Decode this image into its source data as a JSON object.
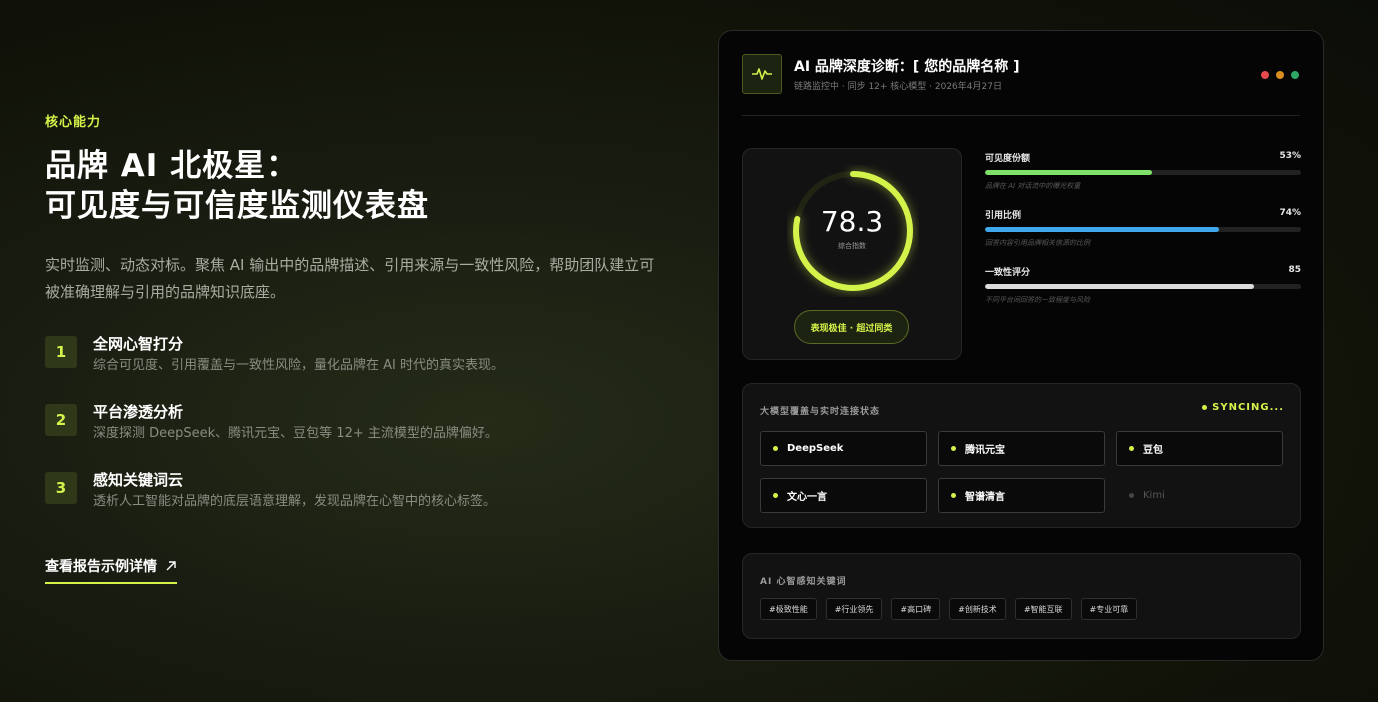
{
  "left": {
    "eyebrow": "核心能力",
    "headline_line1": "品牌 AI 北极星：",
    "headline_line2": "可见度与可信度监测仪表盘",
    "description": "实时监测、动态对标。聚焦 AI 输出中的品牌描述、引用来源与一致性风险，帮助团队建立可被准确理解与引用的品牌知识底座。",
    "features": [
      {
        "num": "1",
        "title": "全网心智打分",
        "desc": "综合可见度、引用覆盖与一致性风险，量化品牌在 AI 时代的真实表现。"
      },
      {
        "num": "2",
        "title": "平台渗透分析",
        "desc": "深度探测 DeepSeek、腾讯元宝、豆包等 12+ 主流模型的品牌偏好。"
      },
      {
        "num": "3",
        "title": "感知关键词云",
        "desc": "透析人工智能对品牌的底层语意理解，发现品牌在心智中的核心标签。"
      }
    ],
    "cta_label": "查看报告示例详情"
  },
  "card": {
    "title": "AI 品牌深度诊断：[ 您的品牌名称 ]",
    "subtitle": "链路监控中 · 同步 12+ 核心模型 · 2026年4月27日",
    "window_dots": [
      "#e5484d",
      "#d98d1f",
      "#2ea866"
    ],
    "gauge": {
      "score": "78.3",
      "score_fraction": 0.783,
      "label": "综合指数",
      "badge": "表现极佳 · 超过同类"
    },
    "metrics": [
      {
        "name": "可见度份额",
        "value": "53%",
        "fill": 0.53,
        "note": "品牌在 AI 对话流中的曝光权重",
        "color": "#7fe06a"
      },
      {
        "name": "引用比例",
        "value": "74%",
        "fill": 0.74,
        "note": "回答内容引用品牌相关信源的比例",
        "color": "#3fa8ec"
      },
      {
        "name": "一致性评分",
        "value": "85",
        "fill": 0.85,
        "note": "不同平台间回答的一致程度与风险",
        "color": "#dcdcdc"
      }
    ],
    "models_label": "大模型覆盖与实时连接状态",
    "sync_label": "SYNCING...",
    "models": [
      {
        "name": "DeepSeek",
        "active": true
      },
      {
        "name": "腾讯元宝",
        "active": true
      },
      {
        "name": "豆包",
        "active": true
      },
      {
        "name": "文心一言",
        "active": true
      },
      {
        "name": "智谱清言",
        "active": true
      },
      {
        "name": "Kimi",
        "active": false
      }
    ],
    "keywords_label": "AI 心智感知关键词",
    "keywords": [
      "#极致性能",
      "#行业领先",
      "#高口碑",
      "#创新技术",
      "#智能互联",
      "#专业可靠"
    ]
  },
  "colors": {
    "accent": "#d4f34a"
  },
  "icons": {
    "logo": "pulse-icon",
    "cta": "arrow-up-right-icon"
  }
}
